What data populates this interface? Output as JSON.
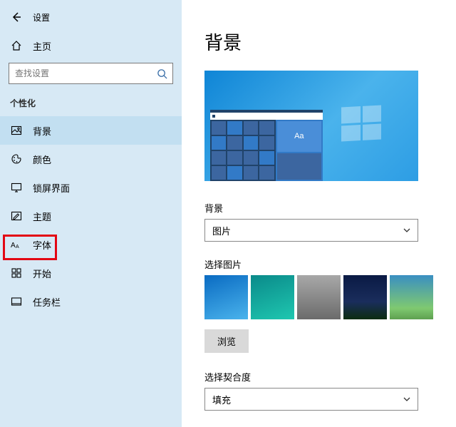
{
  "header": {
    "title": "设置"
  },
  "home": {
    "label": "主页"
  },
  "search": {
    "placeholder": "查找设置"
  },
  "section": {
    "label": "个性化"
  },
  "nav": [
    {
      "id": "background",
      "label": "背景",
      "icon": "picture-icon"
    },
    {
      "id": "colors",
      "label": "颜色",
      "icon": "palette-icon"
    },
    {
      "id": "lockscreen",
      "label": "锁屏界面",
      "icon": "monitor-icon"
    },
    {
      "id": "themes",
      "label": "主题",
      "icon": "pencil-icon"
    },
    {
      "id": "fonts",
      "label": "字体",
      "icon": "font-icon",
      "highlight": true
    },
    {
      "id": "start",
      "label": "开始",
      "icon": "start-icon"
    },
    {
      "id": "taskbar",
      "label": "任务栏",
      "icon": "taskbar-icon"
    }
  ],
  "main": {
    "title": "背景",
    "preview_aa": "Aa",
    "bg_type_label": "背景",
    "bg_type_value": "图片",
    "choose_pic_label": "选择图片",
    "browse_label": "浏览",
    "fit_label": "选择契合度",
    "fit_value": "填充"
  }
}
